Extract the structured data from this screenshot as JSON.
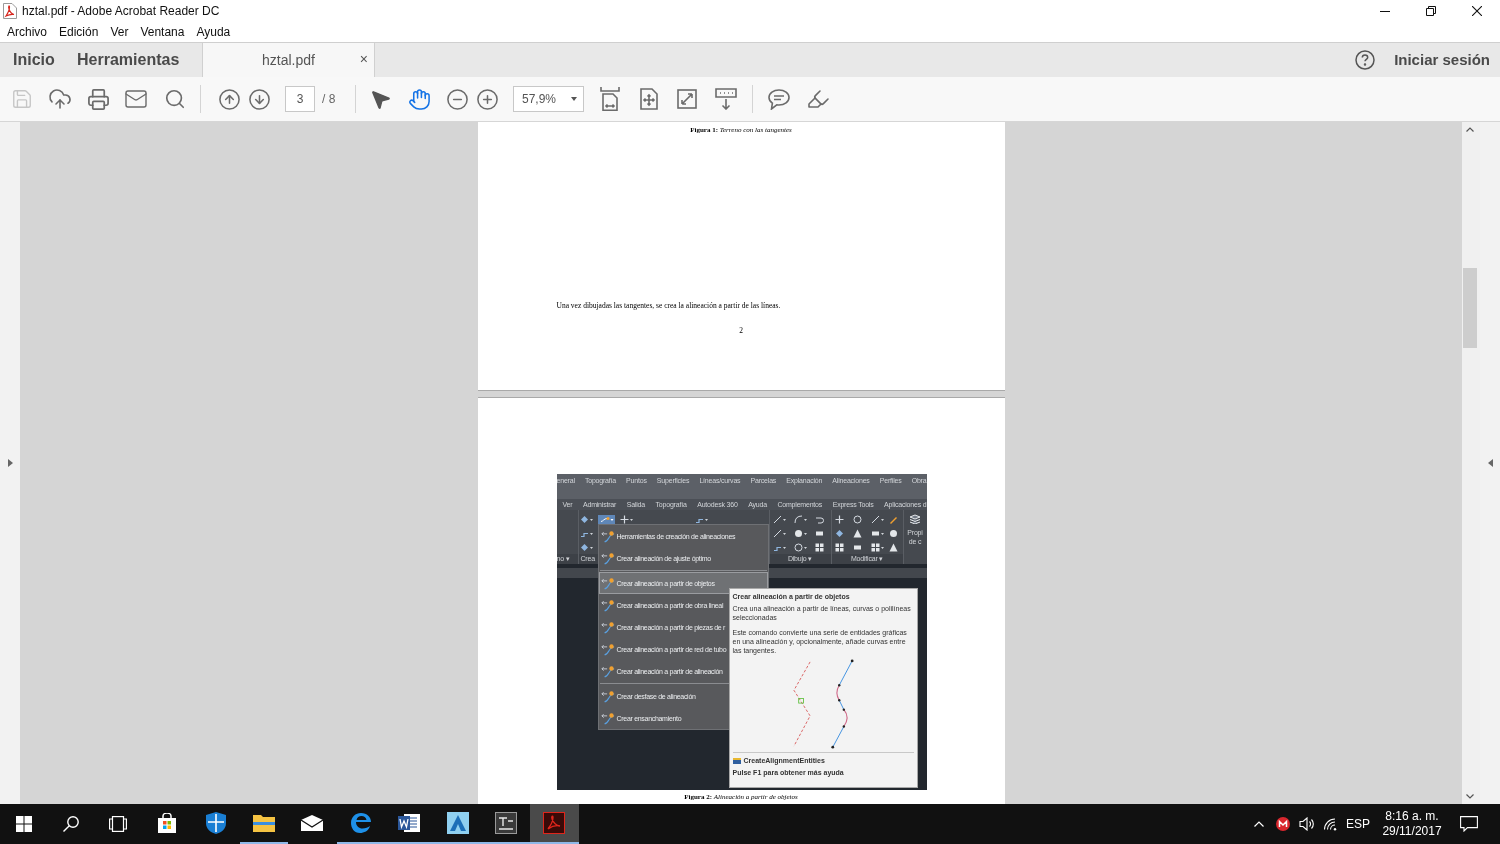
{
  "window": {
    "title": "hztal.pdf - Adobe Acrobat Reader DC"
  },
  "menu_bar": [
    "Archivo",
    "Edición",
    "Ver",
    "Ventana",
    "Ayuda"
  ],
  "tabs": [
    {
      "kind": "nav",
      "label": "Inicio",
      "selected": false
    },
    {
      "kind": "nav",
      "label": "Herramientas",
      "selected": false
    },
    {
      "kind": "document",
      "label": "hztal.pdf",
      "selected": true,
      "close": "×"
    }
  ],
  "account": {
    "sign_in": "Iniciar sesión"
  },
  "toolbar": {
    "save": {
      "disabled": true
    },
    "page": {
      "value": "3",
      "total": "/ 8"
    },
    "tools": [
      {
        "selected": false
      },
      {
        "selected": true
      }
    ],
    "zoom": {
      "value": "57,9%"
    }
  },
  "document": {
    "pages": [
      {
        "kind": "text",
        "caption": "**Figura 1:** *Terreno con las tangentes*",
        "paragraph": "Una vez dibujadas las tangentes, se crea la alineación a partir de las líneas.",
        "page_number": "2"
      },
      {
        "kind": "figure",
        "screenshot": {
          "tabs_row_1": [
            "eneral",
            "Topografía",
            "Puntos",
            "Superficies",
            "Líneas/curvas",
            "Parcelas",
            "Explanación",
            "Alineaciones",
            "Perfiles",
            "Obra"
          ],
          "tabs_row_2": [
            "Ver",
            "Administrar",
            "Salida",
            "Topografía",
            "Autodesk 360",
            "Ayuda",
            "Complementos",
            "Express Tools",
            "Aplicaciones d"
          ],
          "panels": [
            "no ▾",
            "Crea",
            "Dibujo ▾",
            "Modificar ▾"
          ],
          "side_label": [
            "Propi",
            "de c"
          ],
          "menu": {
            "groups": [
              [
                {
                  "label": "Herramientas de creación de alineaciones",
                  "selected": false
                },
                {
                  "label": "Crear alineación de ajuste óptimo",
                  "selected": false
                }
              ],
              [
                {
                  "label": "Crear alineación a partir de objetos",
                  "selected": true
                },
                {
                  "label": "Crear alineación a partir de obra lineal",
                  "selected": false
                },
                {
                  "label": "Crear alineación a partir de piezas de r",
                  "selected": false
                },
                {
                  "label": "Crear alineación a partir de red de tubo",
                  "selected": false
                },
                {
                  "label": "Crear alineación a partir de alineación",
                  "selected": false
                }
              ],
              [
                {
                  "label": "Crear desfase de alineación",
                  "selected": false
                },
                {
                  "label": "Crear ensanchamiento",
                  "selected": false
                }
              ]
            ]
          },
          "tooltip": {
            "title": "Crear alineación a partir de objetos",
            "description": "Crea una alineación a partir de líneas, curvas o polilíneas seleccionadas",
            "details": "Este comando convierte una serie de entidades gráficas en una alineación y, opcionalmente, añade curvas entre las tangentes.",
            "command": "CreateAlignmentEntities",
            "help": "Pulse F1 para obtener más ayuda"
          }
        },
        "caption": "**Figura 2:** *Alineación a partir de objetos*"
      }
    ]
  },
  "taskbar": {
    "apps": [
      {
        "kind": "store",
        "running": false,
        "active": false
      },
      {
        "kind": "shield",
        "running": false,
        "active": false
      },
      {
        "kind": "folder",
        "running": true,
        "active": false
      },
      {
        "kind": "mail",
        "running": false,
        "active": false
      },
      {
        "kind": "browser",
        "running": true,
        "active": false
      },
      {
        "kind": "word",
        "running": true,
        "active": false
      },
      {
        "kind": "triangle",
        "running": true,
        "active": false
      },
      {
        "kind": "tex",
        "running": true,
        "active": false
      },
      {
        "kind": "pdf",
        "running": true,
        "active": true
      }
    ],
    "tray": {
      "language": "ESP",
      "time": "8:16 a. m.",
      "date": "29/11/2017"
    }
  }
}
